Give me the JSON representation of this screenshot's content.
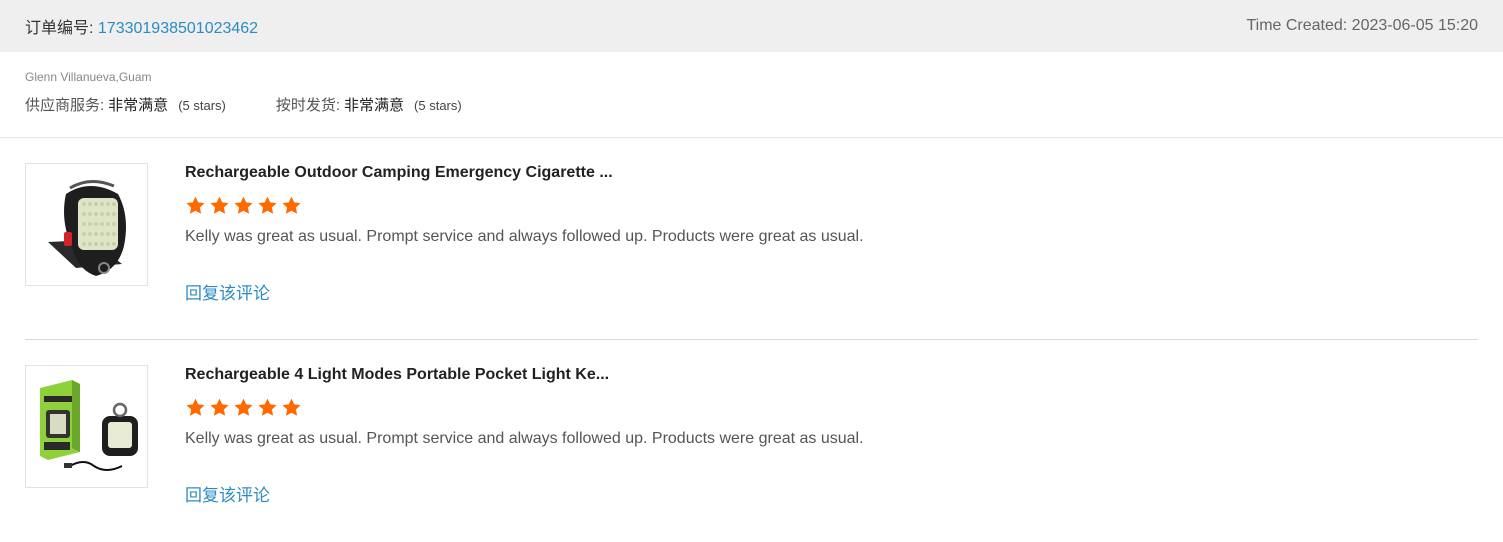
{
  "order": {
    "label": "订单编号:",
    "number": "173301938501023462",
    "time_created": "Time Created: 2023-06-05 15:20"
  },
  "buyer": {
    "name": "Glenn Villanueva,Guam",
    "ratings": [
      {
        "label": "供应商服务:",
        "value": "非常满意",
        "stars": "(5 stars)"
      },
      {
        "label": "按时发货:",
        "value": "非常满意",
        "stars": "(5 stars)"
      }
    ]
  },
  "colors": {
    "star": "#ff6a00",
    "link": "#2b8cc4"
  },
  "reviews": [
    {
      "product": "Rechargeable Outdoor Camping Emergency Cigarette ...",
      "rating": 5,
      "comment": "Kelly was great as usual. Prompt service and always followed up. Products were great as usual.",
      "reply_label": "回复该评论"
    },
    {
      "product": "Rechargeable 4 Light Modes Portable Pocket Light Ke...",
      "rating": 5,
      "comment": "Kelly was great as usual. Prompt service and always followed up. Products were great as usual.",
      "reply_label": "回复该评论"
    }
  ]
}
